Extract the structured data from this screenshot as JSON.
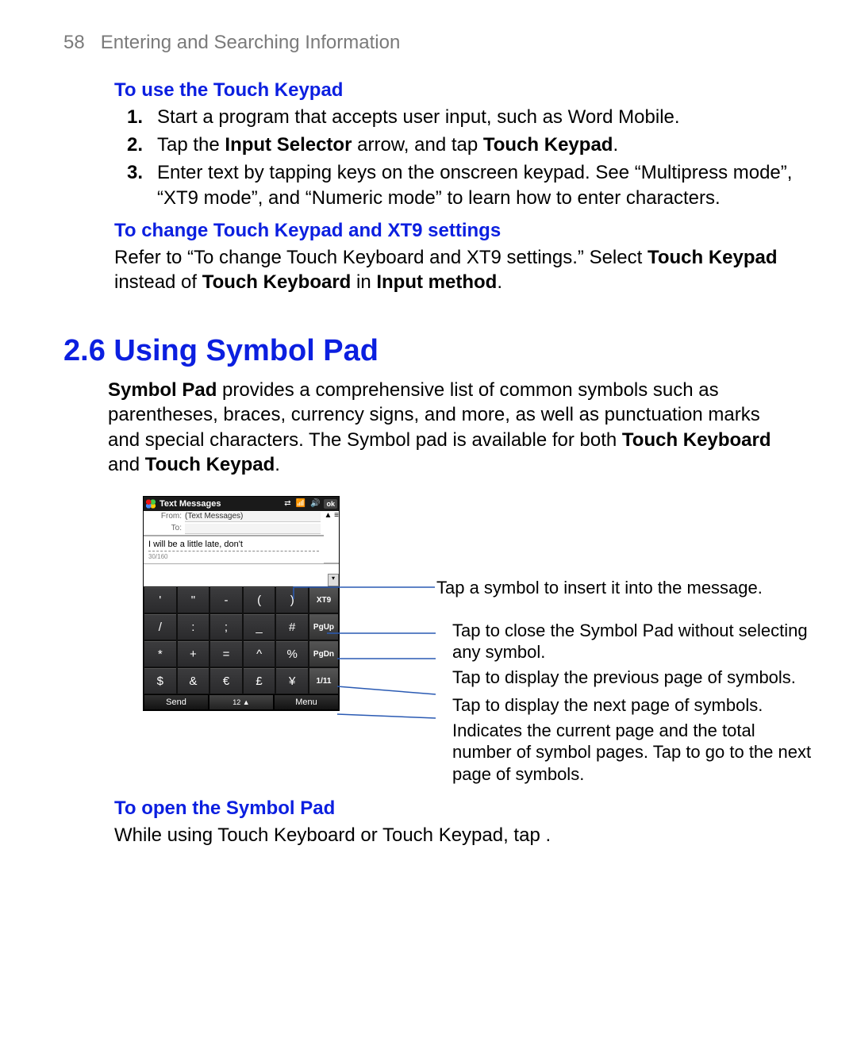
{
  "header": {
    "page_number_text": "58",
    "chapter_title": "Entering and Searching Information"
  },
  "s1": {
    "title": "To use the Touch Keypad",
    "items": [
      {
        "n": "1.",
        "text": "Start a program that accepts user input, such as Word Mobile."
      },
      {
        "n": "2.",
        "text_before": "Tap the ",
        "b1": "Input Selector",
        "text_mid": " arrow, and tap ",
        "b2": "Touch Keypad",
        "text_after": "."
      },
      {
        "n": "3.",
        "text": "Enter text by tapping keys on the onscreen keypad. See “Multipress mode”, “XT9 mode”, and “Numeric mode” to learn how to enter characters."
      }
    ]
  },
  "s2": {
    "title": "To change Touch Keypad and XT9 settings",
    "p_before": "Refer to “To change Touch Keyboard and XT9 settings.” Select ",
    "b1": "Touch Keypad",
    "p_mid": " instead of ",
    "b2": "Touch Keyboard",
    "p_mid2": " in ",
    "b3": "Input method",
    "p_after": "."
  },
  "section26": {
    "heading": "2.6  Using Symbol Pad"
  },
  "s3": {
    "b1": "Symbol Pad",
    "t1": " provides a comprehensive list of common symbols such as parentheses, braces, currency signs, and more, as well as punctuation marks and special characters. The Symbol pad is available for both ",
    "b2": "Touch Keyboard",
    "t2": " and ",
    "b3": "Touch Keypad",
    "t3": "."
  },
  "screenshot": {
    "app_title": "Text Messages",
    "from_label": "From:",
    "from_value": "(Text Messages)",
    "to_label": "To:",
    "typed_text": "I will be a little late, don't",
    "char_count": "30/160",
    "ok": "ok",
    "keys": [
      [
        "'",
        "\"",
        "-",
        "(",
        ")",
        "XT9"
      ],
      [
        "/",
        ":",
        ";",
        "_",
        "#",
        "PgUp"
      ],
      [
        "*",
        "+",
        "=",
        "^",
        "%",
        "PgDn"
      ],
      [
        "$",
        "&",
        "€",
        "£",
        "¥",
        "1/11"
      ]
    ],
    "soft_left": "Send",
    "soft_mid": "12 ▲",
    "soft_right": "Menu"
  },
  "callouts": {
    "c1": "Tap a symbol to insert it into the message.",
    "c2": "Tap to close the Symbol Pad without selecting any symbol.",
    "c3": "Tap to display the previous page of symbols.",
    "c4": "Tap to display the next page of symbols.",
    "c5": "Indicates the current page and the total number of symbol pages. Tap to go to the next page of symbols."
  },
  "s4": {
    "title": "To open the Symbol Pad",
    "text": "While using Touch Keyboard or Touch Keypad, tap         ."
  }
}
